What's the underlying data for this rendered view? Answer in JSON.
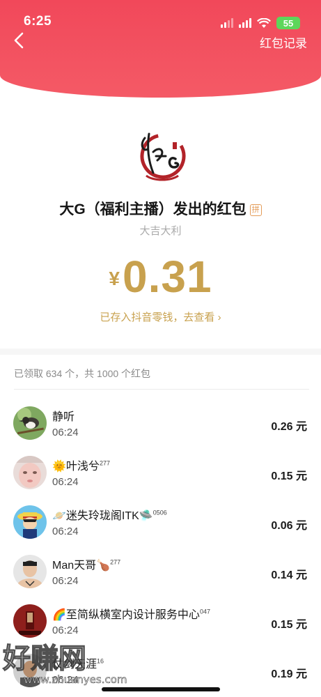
{
  "status_bar": {
    "time": "6:25",
    "battery": "55"
  },
  "header": {
    "records_label": "红包记录"
  },
  "envelope": {
    "sender_title": "大G（福利主播）发出的红包",
    "badge": "拼",
    "blessing": "大吉大利",
    "currency": "¥",
    "amount": "0.31",
    "wallet_link": "已存入抖音零钱，去查看 ›"
  },
  "summary": "已领取 634 个，共 1000 个红包",
  "recipients": [
    {
      "name": "静听",
      "sup": "",
      "time": "06:24",
      "amount": "0.26 元"
    },
    {
      "name": "🌞叶浅兮",
      "sup": "277",
      "time": "06:24",
      "amount": "0.15 元"
    },
    {
      "name": "🪐迷失玲珑阁ITK🛸",
      "sup": "0506",
      "time": "06:24",
      "amount": "0.06 元"
    },
    {
      "name": "Man天哥🍗",
      "sup": "277",
      "time": "06:24",
      "amount": "0.14 元"
    },
    {
      "name": "🌈至简纵横室内设计服务中心",
      "sup": "047",
      "time": "06:24",
      "amount": "0.15 元"
    },
    {
      "name": "仗剑天涯",
      "sup": "16",
      "time": "06:24",
      "amount": "0.19 元"
    }
  ],
  "watermark": {
    "text": "好赚网",
    "url": "www.zhuanyes.com"
  },
  "colors": {
    "banner": "#f1485a",
    "gold": "#c8a14e"
  }
}
